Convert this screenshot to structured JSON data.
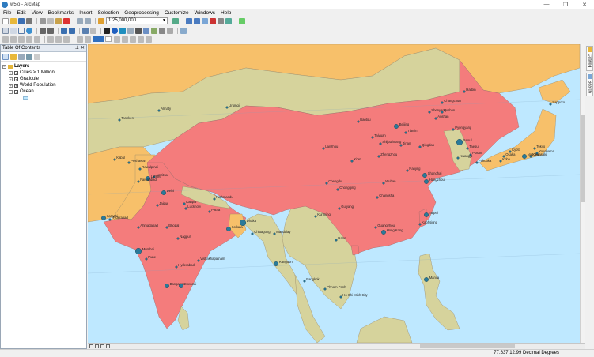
{
  "window": {
    "title": "w5lo - ArcMap",
    "controls": [
      "—",
      "❐",
      "✕"
    ]
  },
  "menu": [
    "File",
    "Edit",
    "View",
    "Bookmarks",
    "Insert",
    "Selection",
    "Geoprocessing",
    "Customize",
    "Windows",
    "Help"
  ],
  "toolbar": {
    "scale_value": "1:25,000,000"
  },
  "toc": {
    "title": "Table Of Contents",
    "root": "Layers",
    "layers": [
      {
        "name": "Cities > 1 Million",
        "checked": true
      },
      {
        "name": "Graticule",
        "checked": true
      },
      {
        "name": "World Population",
        "checked": true
      },
      {
        "name": "Ocean",
        "checked": true
      }
    ]
  },
  "side_tabs": [
    "Catalog",
    "Search"
  ],
  "status": {
    "coordinates": "77.637  12.99 Decimal Degrees"
  },
  "colors": {
    "ocean": "#bee8ff",
    "land_olive": "#d6d39c",
    "land_orange": "#f7c06a",
    "china_red": "#f47c7c",
    "city_dot": "#2a7a9a"
  },
  "cities": [
    {
      "name": "Harbin",
      "size": 1
    },
    {
      "name": "Changchun",
      "size": 1
    },
    {
      "name": "Shenyang",
      "size": 1
    },
    {
      "name": "Fushun",
      "size": 1
    },
    {
      "name": "Anshan",
      "size": 1
    },
    {
      "name": "Beijing",
      "size": 2
    },
    {
      "name": "Tianjin",
      "size": 1
    },
    {
      "name": "Baotou",
      "size": 1
    },
    {
      "name": "Taiyuan",
      "size": 1
    },
    {
      "name": "Shijiazhuang",
      "size": 1
    },
    {
      "name": "Jinan",
      "size": 1
    },
    {
      "name": "Qingdao",
      "size": 1
    },
    {
      "name": "Pyongyang",
      "size": 1
    },
    {
      "name": "Seoul",
      "size": 3
    },
    {
      "name": "Taegu",
      "size": 1
    },
    {
      "name": "Pusan",
      "size": 1
    },
    {
      "name": "Kwangju",
      "size": 1
    },
    {
      "name": "Sapporo",
      "size": 1
    },
    {
      "name": "Tokyo",
      "size": 1
    },
    {
      "name": "Yokohama",
      "size": 1
    },
    {
      "name": "Kawasaki",
      "size": 1
    },
    {
      "name": "Nagoya",
      "size": 2
    },
    {
      "name": "Osaka",
      "size": 1
    },
    {
      "name": "Kobe",
      "size": 1
    },
    {
      "name": "Kyoto",
      "size": 1
    },
    {
      "name": "Fukuoka",
      "size": 1
    },
    {
      "name": "Lanzhou",
      "size": 1
    },
    {
      "name": "Xi'an",
      "size": 1
    },
    {
      "name": "Zhengzhou",
      "size": 1
    },
    {
      "name": "Nanjing",
      "size": 1
    },
    {
      "name": "Shanghai",
      "size": 2
    },
    {
      "name": "Hangzhou",
      "size": 2
    },
    {
      "name": "Wuhan",
      "size": 1
    },
    {
      "name": "Chengdu",
      "size": 1
    },
    {
      "name": "Chongqing",
      "size": 1
    },
    {
      "name": "Changsha",
      "size": 1
    },
    {
      "name": "Guiyang",
      "size": 1
    },
    {
      "name": "Kunming",
      "size": 1
    },
    {
      "name": "Guangzhou",
      "size": 1
    },
    {
      "name": "Hong Kong",
      "size": 2
    },
    {
      "name": "Taipei",
      "size": 2
    },
    {
      "name": "Kaohsiung",
      "size": 1
    },
    {
      "name": "Hanoi",
      "size": 1
    },
    {
      "name": "Bangkok",
      "size": 1
    },
    {
      "name": "Phnom Penh",
      "size": 1
    },
    {
      "name": "Ho Chi Minh City",
      "size": 1
    },
    {
      "name": "Manila",
      "size": 2
    },
    {
      "name": "Rangoon",
      "size": 2
    },
    {
      "name": "Mandalay",
      "size": 1
    },
    {
      "name": "Dhaka",
      "size": 3
    },
    {
      "name": "Chittagong",
      "size": 1
    },
    {
      "name": "Kolkata",
      "size": 2
    },
    {
      "name": "Patna",
      "size": 1
    },
    {
      "name": "Kathmandu",
      "size": 1
    },
    {
      "name": "Lucknow",
      "size": 1
    },
    {
      "name": "Kanpur",
      "size": 1
    },
    {
      "name": "Delhi",
      "size": 2
    },
    {
      "name": "Jaipur",
      "size": 1
    },
    {
      "name": "Amritsar",
      "size": 1
    },
    {
      "name": "Lahore",
      "size": 2
    },
    {
      "name": "Faisalabad",
      "size": 1
    },
    {
      "name": "Rawalpindi",
      "size": 1
    },
    {
      "name": "Peshawar",
      "size": 1
    },
    {
      "name": "Kabul",
      "size": 1
    },
    {
      "name": "Hyderabad",
      "size": 1
    },
    {
      "name": "Karachi",
      "size": 2
    },
    {
      "name": "Ahmadabad",
      "size": 1
    },
    {
      "name": "Bhopal",
      "size": 1
    },
    {
      "name": "Nagpur",
      "size": 1
    },
    {
      "name": "Mumbai",
      "size": 3
    },
    {
      "name": "Pune",
      "size": 1
    },
    {
      "name": "Hyderabad",
      "size": 1
    },
    {
      "name": "Vishakhapatnam",
      "size": 1
    },
    {
      "name": "Bangalore",
      "size": 2
    },
    {
      "name": "Chennai",
      "size": 2
    },
    {
      "name": "Tashkent",
      "size": 1
    },
    {
      "name": "Almaty",
      "size": 1
    },
    {
      "name": "Urumqi",
      "size": 1
    }
  ]
}
